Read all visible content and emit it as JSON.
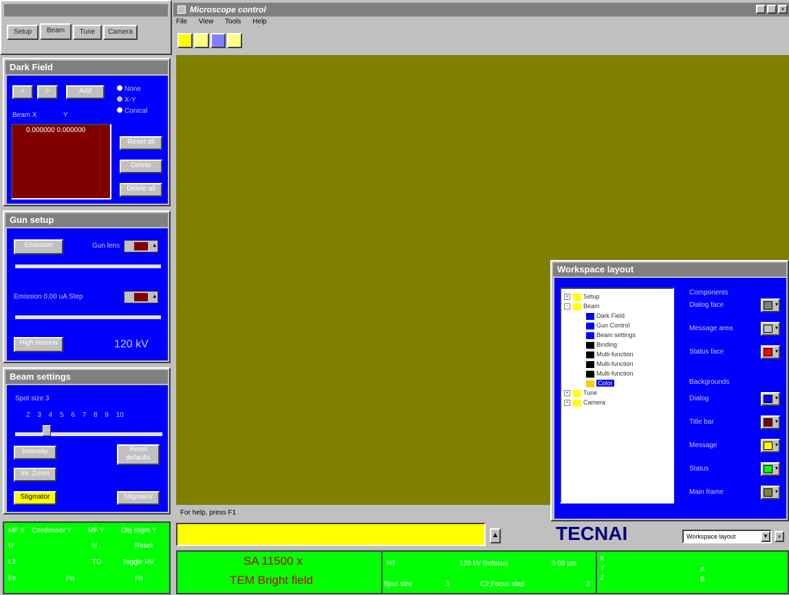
{
  "left": {
    "tabs": [
      "Setup",
      "Beam",
      "Tune",
      "Camera"
    ],
    "dark_field": {
      "title": "Dark Field",
      "btn_prev": "<",
      "btn_next": ">",
      "btn_add": "Add",
      "radio_none": "None",
      "radio_xy": "X-Y",
      "radio_conical": "Conical",
      "col_x": "Beam X",
      "col_y": "Y",
      "list_value": "0.000000 0.000000",
      "btn_reset_all": "Reset all",
      "btn_delete": "Delete",
      "btn_delete_all": "Delete all"
    },
    "gun_setup": {
      "title": "Gun setup",
      "btn_emission": "Emission",
      "label_gun_lens": "Gun lens",
      "label_emission": "Emission 0.00 uA Step",
      "btn_high_tension": "High tension",
      "kv_value": "120 kV"
    },
    "beam_settings": {
      "title": "Beam settings",
      "label_spot": "Spot size 3",
      "spot_numbers": "2 3 4 5 6 7 8 9 10",
      "btn_intensity": "Intensity",
      "btn_reset_defaults": "Reset defaults",
      "btn_zoom": "Int. Zoom",
      "btn_stigmator_left": "Stigmator",
      "btn_stigmator_right": "Stigmator"
    }
  },
  "status_left": {
    "r1c1": "MF X",
    "r1c2": "Condenser Y",
    "r1c3": "MF Y",
    "r1c4": "Obj stigm Y",
    "r2c1": "U",
    "r2c2": "U",
    "r2c3": "Reset",
    "r3c1": "L2",
    "r3c2": "TD",
    "r3c3": "Toggle HV",
    "r4c1": "Fn",
    "r4c2": "Fn",
    "r4c3": "Fn"
  },
  "window": {
    "title": "Microscope control",
    "menu": [
      "File",
      "View",
      "Tools",
      "Help"
    ],
    "status_text": "For help, press F1"
  },
  "workspace": {
    "title": "Workspace layout",
    "tree": [
      {
        "label": "Setup",
        "level": 0,
        "kind": "folder",
        "expander": "+"
      },
      {
        "label": "Beam",
        "level": 0,
        "kind": "folder",
        "expander": "-"
      },
      {
        "label": "Dark Field",
        "level": 1,
        "kind": "page"
      },
      {
        "label": "Gun Control",
        "level": 1,
        "kind": "page"
      },
      {
        "label": "Beam settings",
        "level": 1,
        "kind": "page"
      },
      {
        "label": "Binding",
        "level": 1,
        "kind": "fill"
      },
      {
        "label": "Multi-function",
        "level": 1,
        "kind": "fill"
      },
      {
        "label": "Multi-function",
        "level": 1,
        "kind": "fill"
      },
      {
        "label": "Multi-function",
        "level": 1,
        "kind": "fill"
      },
      {
        "label": "Color",
        "level": 1,
        "kind": "selected"
      },
      {
        "label": "Tune",
        "level": 0,
        "kind": "folder",
        "expander": "+"
      },
      {
        "label": "Camera",
        "level": 0,
        "kind": "folder",
        "expander": "+"
      }
    ],
    "section1": "Components",
    "section2": "Backgrounds",
    "colors": [
      {
        "label": "Dialog face",
        "color": "#808080"
      },
      {
        "label": "Message area",
        "color": "#c0c0c0"
      },
      {
        "label": "Status face",
        "color": "#ff0000"
      },
      {
        "label": "Dialog",
        "color": "#0000ff"
      },
      {
        "label": "Title bar",
        "color": "#800000"
      },
      {
        "label": "Message",
        "color": "#ffff00"
      },
      {
        "label": "Status",
        "color": "#00ff00"
      },
      {
        "label": "Main frame",
        "color": "#808040"
      }
    ]
  },
  "bottom": {
    "logo": "TECNAI",
    "dropdown_value": "Workspace layout",
    "mag": "SA 11500 x",
    "mode": "TEM Bright field",
    "ht_label": "HT",
    "ht_value": "120 kV Defocus",
    "defocus_value": "0.00 µm",
    "spot_label": "Spot size",
    "spot_value": "3",
    "int_label": "C2 Focus step",
    "int_value": "3",
    "xyz": "X Y Z",
    "ab": "A B"
  },
  "colors": {
    "canvas": "#808000",
    "panel_blue": "#0000ff",
    "status_green": "#00ff00",
    "message_yellow": "#ffff00",
    "list_maroon": "#800000"
  }
}
